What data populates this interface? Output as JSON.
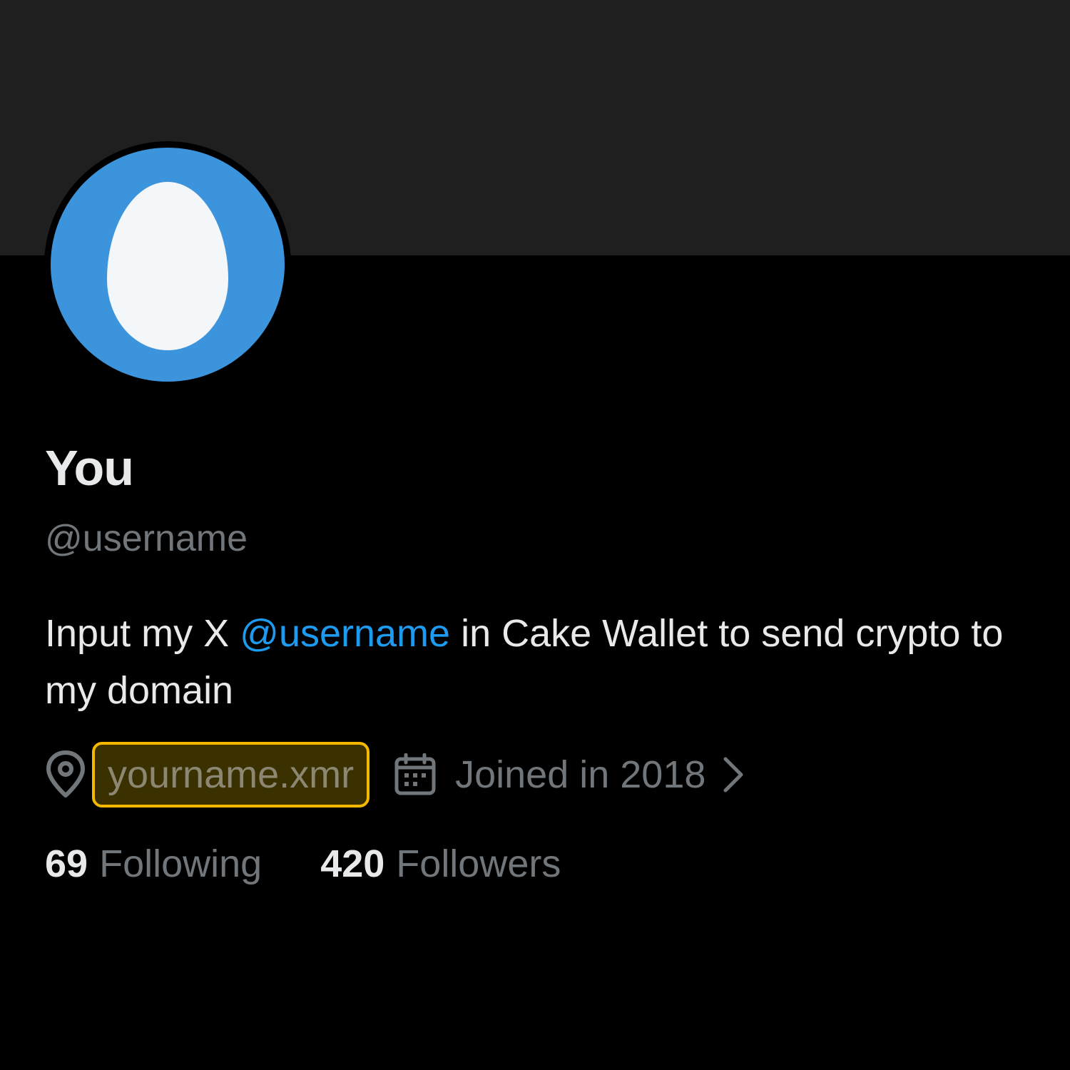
{
  "profile": {
    "display_name": "You",
    "handle": "@username",
    "bio": {
      "prefix": "Input my X ",
      "mention": "@username",
      "suffix": " in Cake Wallet to send crypto to my domain"
    },
    "location": "yourname.xmr",
    "joined": "Joined in 2018",
    "following_count": "69",
    "following_label": "Following",
    "followers_count": "420",
    "followers_label": "Followers"
  },
  "icons": {
    "location": "map-pin-icon",
    "joined": "calendar-icon",
    "chevron": "chevron-right-icon",
    "avatar": "default-egg-avatar"
  },
  "colors": {
    "banner": "#1f1f1f",
    "background": "#000000",
    "avatar": "#3c94dc",
    "mention": "#1d9bf0",
    "highlight_border": "#f5b800",
    "secondary_text": "#71767b",
    "primary_text": "#e7e9ea"
  }
}
